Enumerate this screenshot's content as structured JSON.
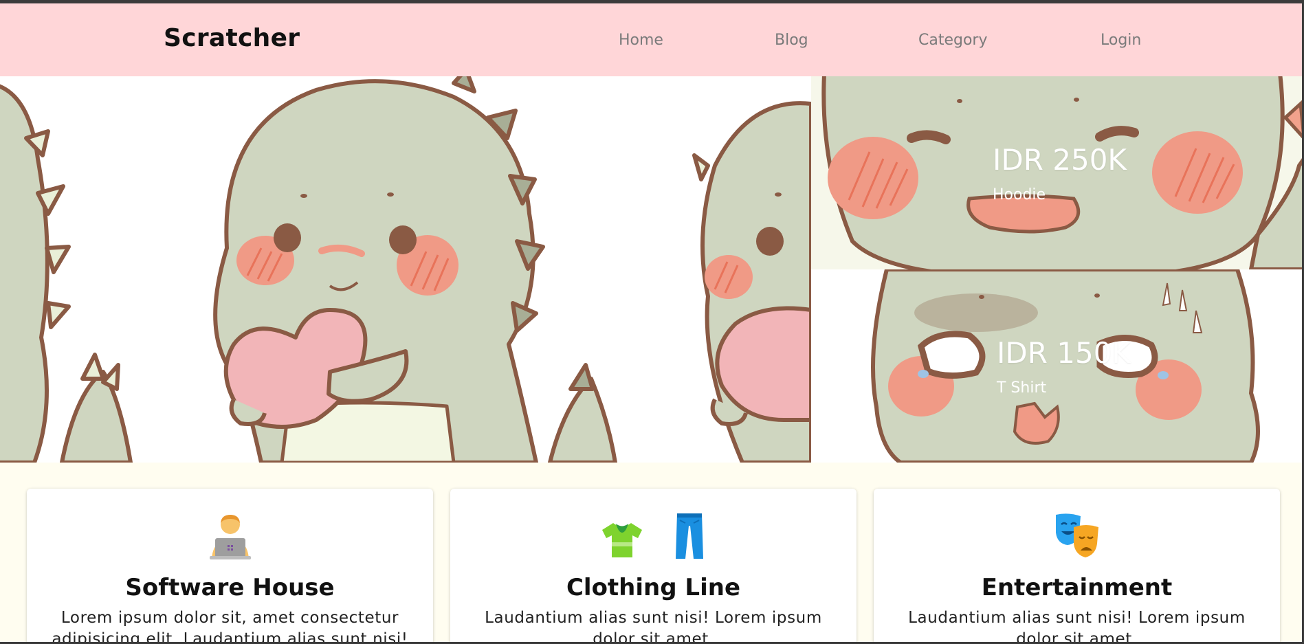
{
  "navbar": {
    "brand": "Scratcher",
    "links": [
      "Home",
      "Blog",
      "Category",
      "Login"
    ]
  },
  "hero": {
    "promo_1": {
      "price": "IDR 250K",
      "product": "Hoodie"
    },
    "promo_2": {
      "price": "IDR 150K",
      "product": "T Shirt"
    }
  },
  "cards": [
    {
      "icons": [
        "technologist-laptop-icon"
      ],
      "title": "Software House",
      "text": "Lorem ipsum dolor sit, amet consectetur adipisicing elit. Laudantium alias sunt nisi!"
    },
    {
      "icons": [
        "tshirt-icon",
        "jeans-icon"
      ],
      "title": "Clothing Line",
      "text": "Laudantium alias sunt nisi! Lorem ipsum dolor sit amet."
    },
    {
      "icons": [
        "theater-masks-icon"
      ],
      "title": "Entertainment",
      "text": "Laudantium alias sunt nisi! Lorem ipsum dolor sit amet."
    }
  ],
  "colors": {
    "navbar_bg": "#ffd6d8",
    "page_bg": "#fffdf0",
    "dino_green": "#cfd6c0",
    "outline_brown": "#8a5a44",
    "blush": "#f09a86",
    "heart_pink": "#f2b5b8"
  }
}
